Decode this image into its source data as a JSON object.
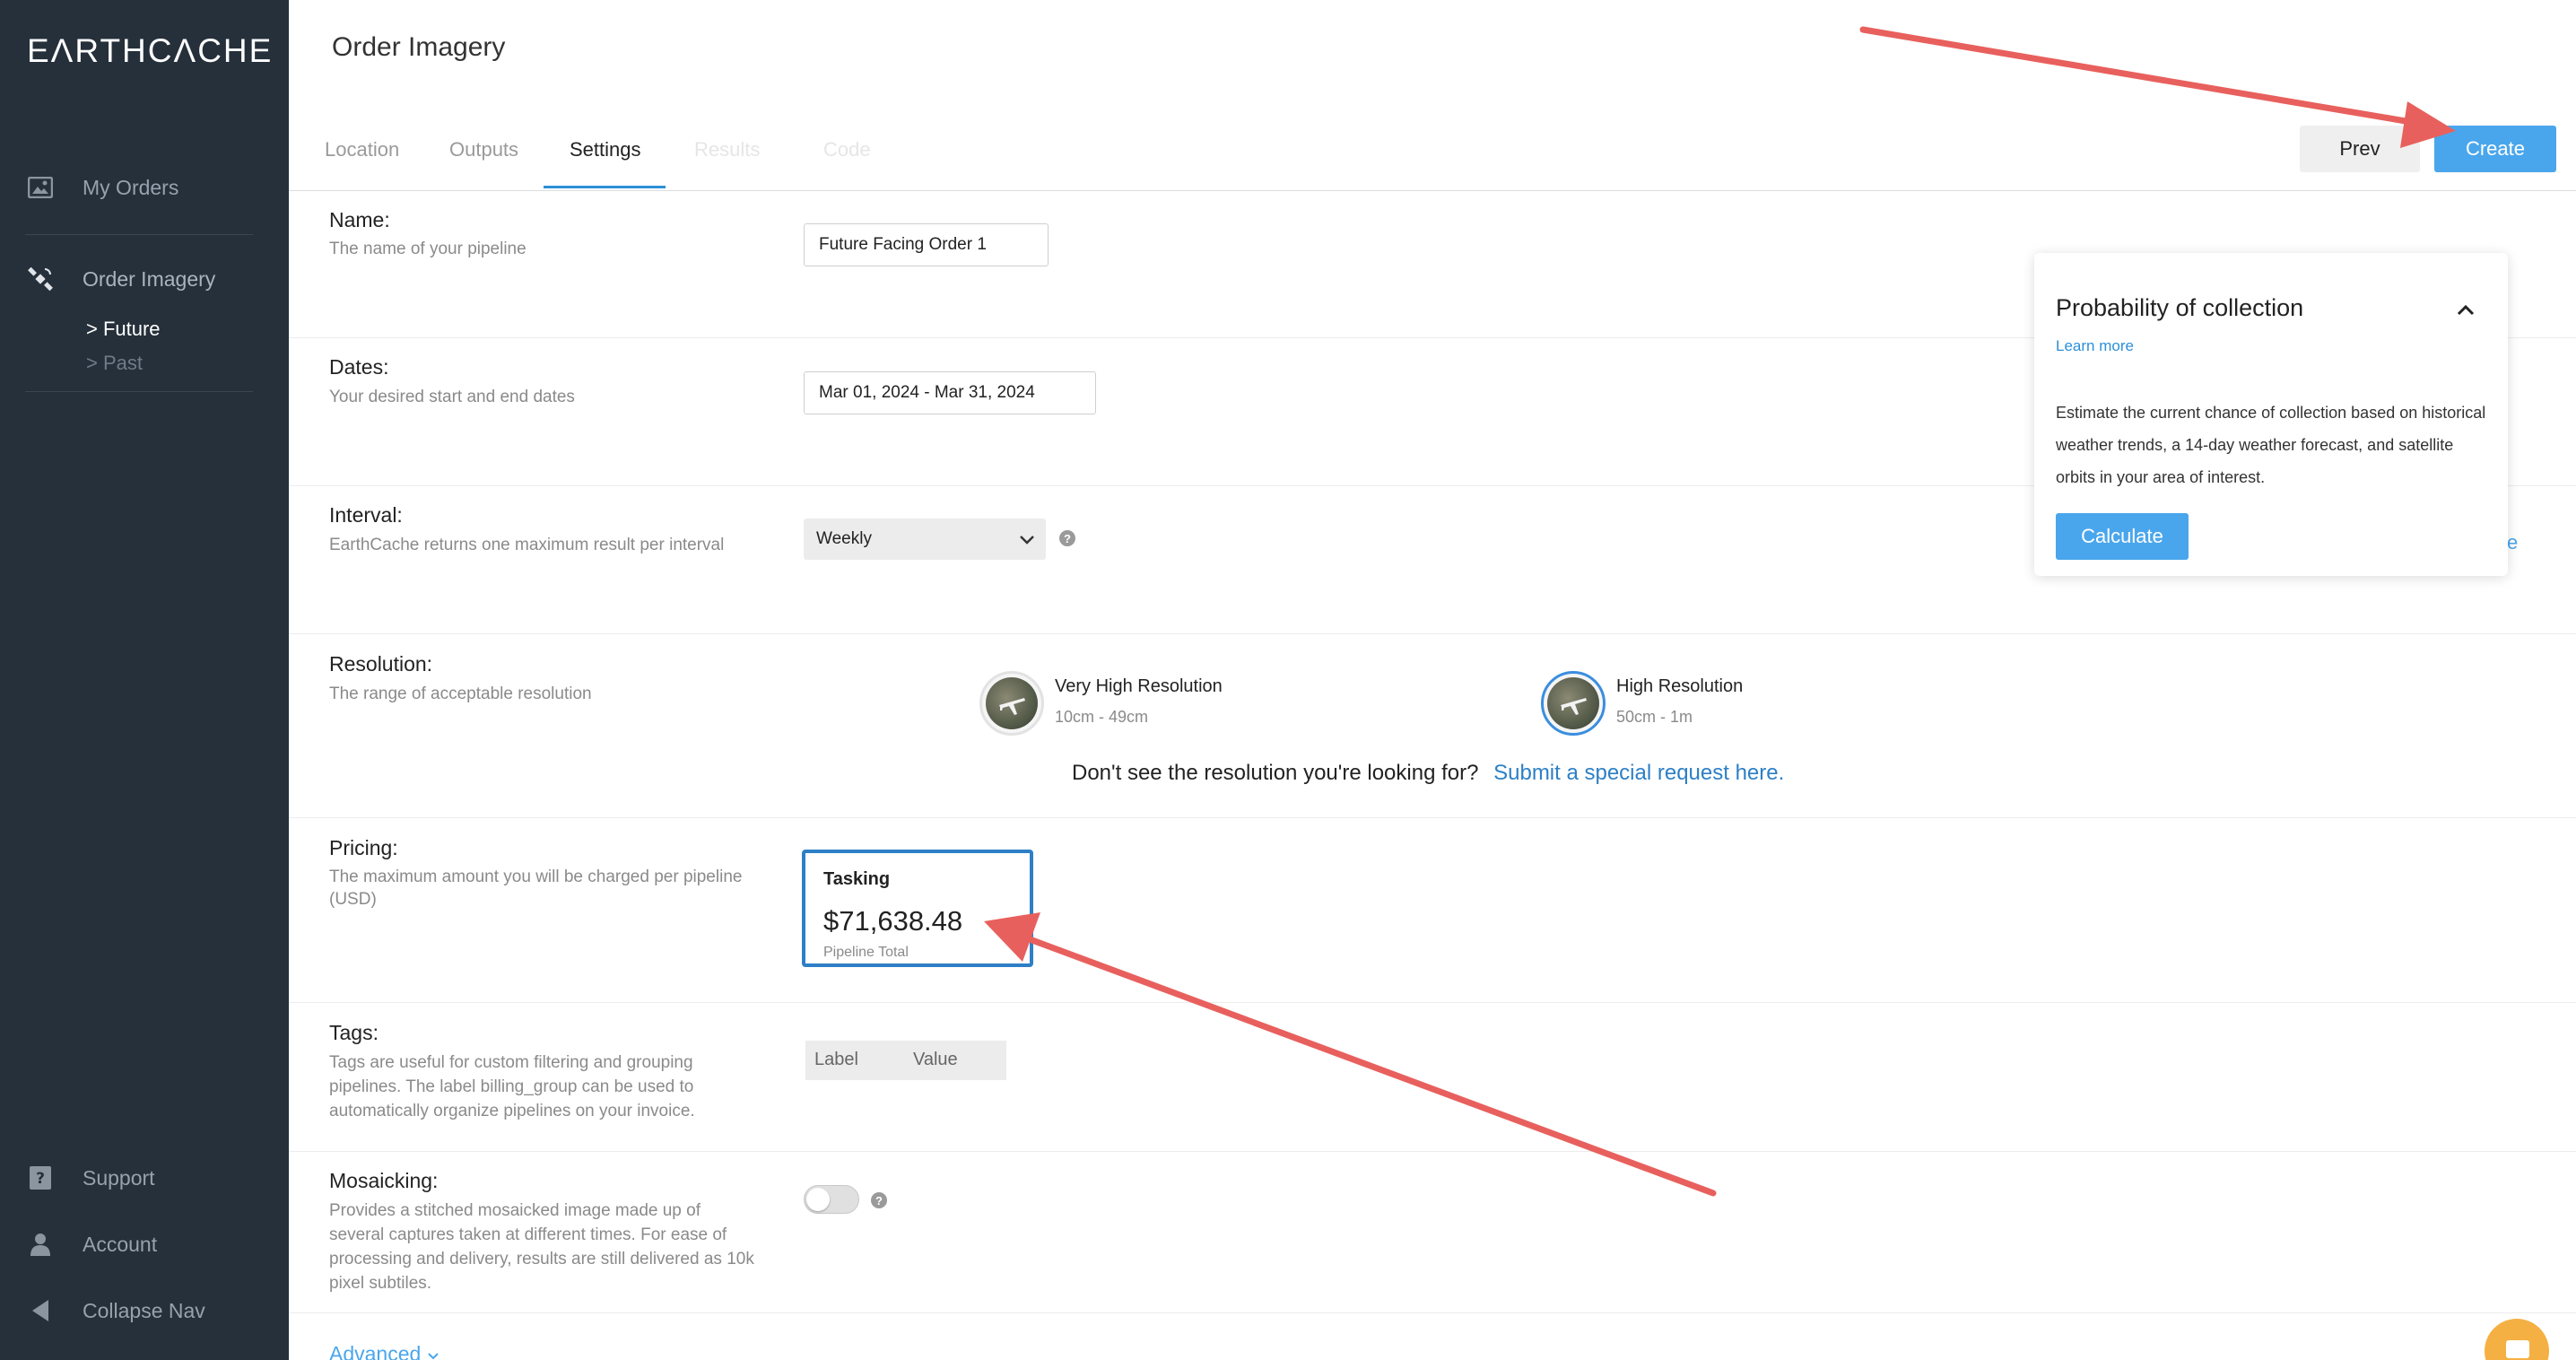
{
  "sidebar": {
    "logo": "EΛRTHCΛCHE",
    "items": [
      {
        "label": "My Orders",
        "icon": "image-icon"
      },
      {
        "label": "Order Imagery",
        "icon": "satellite-icon"
      },
      {
        "label": "Support",
        "icon": "help-icon"
      },
      {
        "label": "Account",
        "icon": "user-icon"
      },
      {
        "label": "Collapse Nav",
        "icon": "triangle-left-icon"
      }
    ],
    "sub_items": [
      {
        "label": "> Future",
        "active": true
      },
      {
        "label": "> Past",
        "active": false
      }
    ]
  },
  "header": {
    "title": "Order Imagery",
    "tabs": [
      {
        "label": "Location",
        "state": "inactive"
      },
      {
        "label": "Outputs",
        "state": "inactive"
      },
      {
        "label": "Settings",
        "state": "active"
      },
      {
        "label": "Results",
        "state": "disabled"
      },
      {
        "label": "Code",
        "state": "disabled"
      }
    ],
    "prev_label": "Prev",
    "create_label": "Create"
  },
  "form": {
    "name": {
      "label": "Name:",
      "desc": "The name of your pipeline",
      "value": "Future Facing Order 1"
    },
    "dates": {
      "label": "Dates:",
      "desc": "Your desired start and end dates",
      "value": "Mar 01, 2024  -  Mar 31, 2024"
    },
    "interval": {
      "label": "Interval:",
      "desc": "EarthCache returns one maximum result per interval",
      "value": "Weekly",
      "help": "?"
    },
    "resolution": {
      "label": "Resolution:",
      "desc": "The range of acceptable resolution",
      "options": [
        {
          "title": "Very High Resolution",
          "range": "10cm - 49cm",
          "selected": false
        },
        {
          "title": "High Resolution",
          "range": "50cm - 1m",
          "selected": true
        }
      ],
      "request_text": "Don't see the resolution you're looking for?",
      "request_link": "Submit a special request here."
    },
    "pricing": {
      "label": "Pricing:",
      "desc_line1": "The maximum amount you will be charged per pipeline",
      "desc_line2": "(USD)",
      "card_title": "Tasking",
      "amount": "$71,638.48",
      "amount_caption": "Pipeline Total"
    },
    "tags": {
      "label": "Tags:",
      "desc_line1": "Tags are useful for custom filtering and grouping",
      "desc_line2": "pipelines. The label billing_group can be used to",
      "desc_line3": "automatically organize pipelines on your invoice.",
      "key_placeholder": "Label",
      "value_placeholder": "Value"
    },
    "mosaicking": {
      "label": "Mosaicking:",
      "desc_line1": "Provides a stitched mosaicked image made up of",
      "desc_line2": "several captures taken at different times. For ease of",
      "desc_line3": "processing and delivery, results are still delivered as 10k",
      "desc_line4": "pixel subtiles.",
      "enabled": false,
      "help": "?"
    },
    "advanced_label": "Advanced"
  },
  "popover": {
    "title": "Probability of collection",
    "learn_more": "Learn more",
    "text": "Estimate the current chance of collection based on historical weather trends, a 14-day weather forecast, and satellite orbits in your area of interest.",
    "button": "Calculate",
    "behind_fragment": "ze"
  },
  "colors": {
    "sidebar_bg": "#25303b",
    "accent": "#4aa6ec",
    "link": "#2d7fc6",
    "annotation_arrow": "#e8605d",
    "chat_bubble": "#f5b043"
  }
}
